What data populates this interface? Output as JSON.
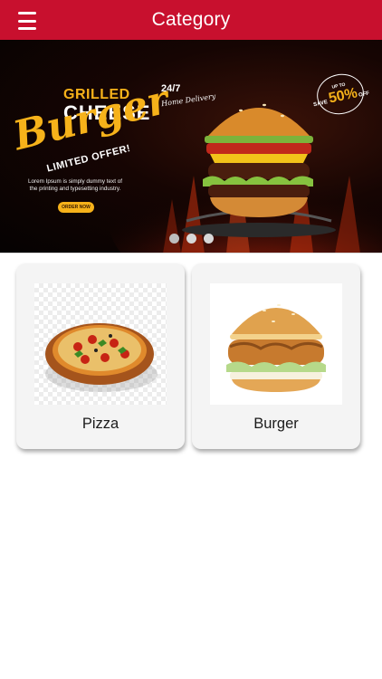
{
  "app_bar": {
    "title": "Category",
    "menu_icon": "hamburger-menu-icon",
    "background": "#c8102e"
  },
  "banner": {
    "grilled": "GRILLED",
    "cheese": "CHEESE",
    "burger": "Burger",
    "limited_offer": "LIMITED OFFER!",
    "body_text": "Lorem Ipsum is simply dummy text of the printing and typesetting industry.",
    "order_button": "ORDER NOW",
    "hours": "24/7",
    "home_delivery": "Home Delivery",
    "badge_up_to": "UP TO",
    "badge_save": "SAVE",
    "badge_percent": "50%",
    "badge_off": "OFF",
    "accent": "#f6b21a",
    "carousel_dots": 3,
    "active_dot": 1
  },
  "categories": [
    {
      "label": "Pizza",
      "image": "pizza-image"
    },
    {
      "label": "Burger",
      "image": "burger-image"
    }
  ]
}
